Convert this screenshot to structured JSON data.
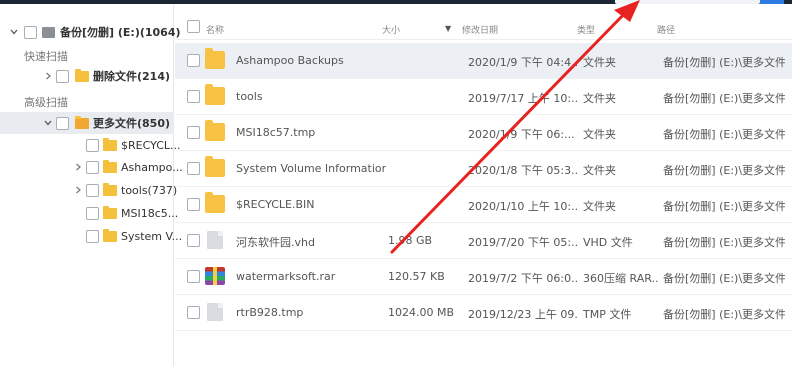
{
  "sidebar": {
    "root": {
      "label": "备份[勿删] (E:)(1064)"
    },
    "quick_scan_label": "快速扫描",
    "deleted_files": {
      "label": "删除文件(214)"
    },
    "advanced_scan_label": "高级扫描",
    "more_files": {
      "label": "更多文件(850)"
    },
    "children": [
      {
        "label": "$RECYCL..."
      },
      {
        "label": "Ashampo..."
      },
      {
        "label": "tools(737)"
      },
      {
        "label": "MSI18c5..."
      },
      {
        "label": "System V..."
      }
    ]
  },
  "table": {
    "headers": {
      "name": "名称",
      "size": "大小",
      "modified": "修改日期",
      "type": "类型",
      "path": "路径"
    },
    "rows": [
      {
        "name": "Ashampoo Backups",
        "size": "",
        "modified": "2020/1/9 下午 04:4...",
        "type": "文件夹",
        "path": "备份[勿删] (E:)\\更多文件\\...",
        "icon": "folder-icon"
      },
      {
        "name": "tools",
        "size": "",
        "modified": "2019/7/17 上午 10:...",
        "type": "文件夹",
        "path": "备份[勿删] (E:)\\更多文件\\...",
        "icon": "folder-icon"
      },
      {
        "name": "MSI18c57.tmp",
        "size": "",
        "modified": "2020/1/9 下午 06:...",
        "type": "文件夹",
        "path": "备份[勿删] (E:)\\更多文件\\...",
        "icon": "folder-icon"
      },
      {
        "name": "System Volume Information",
        "size": "",
        "modified": "2020/1/8 下午 05:3...",
        "type": "文件夹",
        "path": "备份[勿删] (E:)\\更多文件\\...",
        "icon": "folder-icon"
      },
      {
        "name": "$RECYCLE.BIN",
        "size": "",
        "modified": "2020/1/10 上午 10:...",
        "type": "文件夹",
        "path": "备份[勿删] (E:)\\更多文件\\...",
        "icon": "folder-icon"
      },
      {
        "name": "河东软件园.vhd",
        "size": "1.98 GB",
        "modified": "2019/7/20 下午 05:...",
        "type": "VHD 文件",
        "path": "备份[勿删] (E:)\\更多文件\\...",
        "icon": "file-icon"
      },
      {
        "name": "watermarksoft.rar",
        "size": "120.57 KB",
        "modified": "2019/7/2 下午 06:0...",
        "type": "360压缩 RAR...",
        "path": "备份[勿删] (E:)\\更多文件\\...",
        "icon": "rar-archive-icon"
      },
      {
        "name": "rtrB928.tmp",
        "size": "1024.00 MB",
        "modified": "2019/12/23 上午 09...",
        "type": "TMP 文件",
        "path": "备份[勿删] (E:)\\更多文件\\...",
        "icon": "file-icon"
      }
    ]
  },
  "colors": {
    "accent_blue": "#2f7be6",
    "folder_yellow": "#f7c244",
    "annotation_red": "#e8231f",
    "selected_row": "#eceff4"
  }
}
